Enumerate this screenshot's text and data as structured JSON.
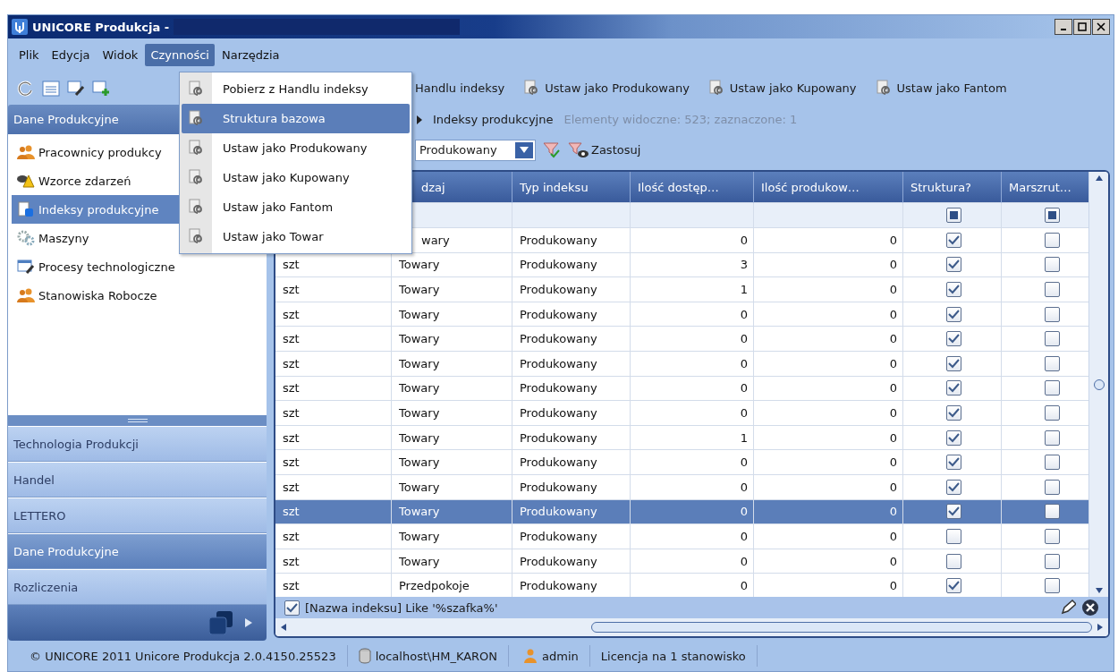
{
  "window": {
    "title": "UNICORE Produkcja -"
  },
  "menu_bar": [
    {
      "label": "Plik",
      "selected": false
    },
    {
      "label": "Edycja",
      "selected": false
    },
    {
      "label": "Widok",
      "selected": false
    },
    {
      "label": "Czynności",
      "selected": true
    },
    {
      "label": "Narzędzia",
      "selected": false
    }
  ],
  "open_menu": [
    {
      "label": "Pobierz z Handlu indeksy",
      "selected": false
    },
    {
      "label": "Struktura bazowa",
      "selected": true
    },
    {
      "label": "Ustaw jako Produkowany",
      "selected": false
    },
    {
      "label": "Ustaw jako Kupowany",
      "selected": false
    },
    {
      "label": "Ustaw jako Fantom",
      "selected": false
    },
    {
      "label": "Ustaw jako Towar",
      "selected": false
    }
  ],
  "toolbar": [
    {
      "label": "Handlu indeksy",
      "covered": true
    },
    {
      "label": "Ustaw jako Produkowany",
      "covered": false
    },
    {
      "label": "Ustaw jako Kupowany",
      "covered": false
    },
    {
      "label": "Ustaw jako Fantom",
      "covered": false
    }
  ],
  "sidebar": {
    "title": "Dane Produkcyjne",
    "items": [
      {
        "label": "Pracownicy produkcy",
        "kind": "people",
        "selected": false
      },
      {
        "label": "Wzorce zdarzeń",
        "kind": "warning",
        "selected": false
      },
      {
        "label": "Indeksy produkcyjne",
        "kind": "index",
        "selected": true
      },
      {
        "label": "Maszyny",
        "kind": "gear",
        "selected": false
      },
      {
        "label": "Procesy technologiczne",
        "kind": "process",
        "selected": false
      },
      {
        "label": "Stanowiska Robocze",
        "kind": "people",
        "selected": false
      }
    ],
    "sections": [
      {
        "label": "Technologia Produkcji",
        "selected": false
      },
      {
        "label": "Handel",
        "selected": false
      },
      {
        "label": "LETTERO",
        "selected": false
      },
      {
        "label": "Dane Produkcyjne",
        "selected": true
      },
      {
        "label": "Rozliczenia",
        "selected": false
      }
    ]
  },
  "breadcrumb": {
    "label": "Indeksy produkcyjne",
    "info": "Elementy widoczne: 523; zaznaczone: 1"
  },
  "filter": {
    "value": "Produkowany",
    "apply": "Zastosuj"
  },
  "table": {
    "columns": [
      {
        "label": "dzaj",
        "covered": true
      },
      {
        "label": "Typ indeksu",
        "covered": false
      },
      {
        "label": "Ilość dostęp…",
        "covered": false
      },
      {
        "label": "Ilość produkow…",
        "covered": false
      },
      {
        "label": "Struktura?",
        "covered": false
      },
      {
        "label": "Marszrut…",
        "covered": false
      }
    ],
    "filter_row": {
      "structure_any": true,
      "route_any": true
    },
    "rows": [
      {
        "group": "wary",
        "type": "Produkowany",
        "available": "0",
        "produced": "0",
        "structure": true,
        "route": false,
        "selected": false,
        "covered": true
      },
      {
        "unit": "szt",
        "group": "Towary",
        "type": "Produkowany",
        "available": "3",
        "produced": "0",
        "structure": true,
        "route": false,
        "selected": false,
        "covered": false
      },
      {
        "unit": "szt",
        "group": "Towary",
        "type": "Produkowany",
        "available": "1",
        "produced": "0",
        "structure": true,
        "route": false,
        "selected": false,
        "covered": false
      },
      {
        "unit": "szt",
        "group": "Towary",
        "type": "Produkowany",
        "available": "0",
        "produced": "0",
        "structure": true,
        "route": false,
        "selected": false,
        "covered": false
      },
      {
        "unit": "szt",
        "group": "Towary",
        "type": "Produkowany",
        "available": "0",
        "produced": "0",
        "structure": true,
        "route": false,
        "selected": false,
        "covered": false
      },
      {
        "unit": "szt",
        "group": "Towary",
        "type": "Produkowany",
        "available": "0",
        "produced": "0",
        "structure": true,
        "route": false,
        "selected": false,
        "covered": false
      },
      {
        "unit": "szt",
        "group": "Towary",
        "type": "Produkowany",
        "available": "0",
        "produced": "0",
        "structure": true,
        "route": false,
        "selected": false,
        "covered": false
      },
      {
        "unit": "szt",
        "group": "Towary",
        "type": "Produkowany",
        "available": "0",
        "produced": "0",
        "structure": true,
        "route": false,
        "selected": false,
        "covered": false
      },
      {
        "unit": "szt",
        "group": "Towary",
        "type": "Produkowany",
        "available": "1",
        "produced": "0",
        "structure": true,
        "route": false,
        "selected": false,
        "covered": false
      },
      {
        "unit": "szt",
        "group": "Towary",
        "type": "Produkowany",
        "available": "0",
        "produced": "0",
        "structure": true,
        "route": false,
        "selected": false,
        "covered": false
      },
      {
        "unit": "szt",
        "group": "Towary",
        "type": "Produkowany",
        "available": "0",
        "produced": "0",
        "structure": true,
        "route": false,
        "selected": false,
        "covered": false
      },
      {
        "unit": "szt",
        "group": "Towary",
        "type": "Produkowany",
        "available": "0",
        "produced": "0",
        "structure": true,
        "route": false,
        "selected": true,
        "covered": false
      },
      {
        "unit": "szt",
        "group": "Towary",
        "type": "Produkowany",
        "available": "0",
        "produced": "0",
        "structure": false,
        "route": false,
        "selected": false,
        "covered": false
      },
      {
        "unit": "szt",
        "group": "Towary",
        "type": "Produkowany",
        "available": "0",
        "produced": "0",
        "structure": false,
        "route": false,
        "selected": false,
        "covered": false
      },
      {
        "unit": "szt",
        "group": "Przedpokoje",
        "type": "Produkowany",
        "available": "0",
        "produced": "0",
        "structure": true,
        "route": false,
        "selected": false,
        "covered": false
      }
    ],
    "filter_bar": {
      "enabled": true,
      "text": "[Nazwa indeksu] Like '%szafka%'"
    }
  },
  "status_bar": [
    "© UNICORE 2011 Unicore Produkcja 2.0.4150.25523",
    "localhost\\HM_KARON",
    "admin",
    "Licencja na 1 stanowisko"
  ]
}
